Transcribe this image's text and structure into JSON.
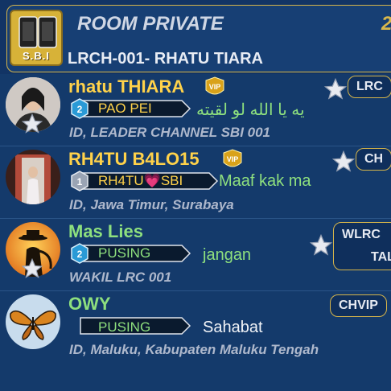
{
  "header": {
    "title": "ROOM PRIVATE",
    "subtitle": "LRCH-001- RHATU TIARA",
    "logo_text": "S.B.I",
    "count_partial": "2"
  },
  "members": [
    {
      "name": "rhatu THIARA",
      "name_color": "#ffd24a",
      "vip": true,
      "level": "2",
      "role": "PAO PEI",
      "message": "يه يا الله لو لقيته",
      "detail": "ID, LEADER CHANNEL SBI 001",
      "tag": "LRC",
      "avatar": "woman-avatar"
    },
    {
      "name": "RH4TU B4LO15",
      "name_color": "#ffd24a",
      "vip": true,
      "level": "1",
      "role": "RH4TU💗SBI",
      "message": "Maaf kak ma",
      "detail": "ID, Jawa Timur, Surabaya",
      "tag": "CH",
      "avatar": "doorway-avatar"
    },
    {
      "name": "Mas Lies",
      "name_color": "#8ee07e",
      "vip": false,
      "level": "2",
      "role": "PUSING",
      "message": "jangan",
      "detail": "WAKIL LRC 001",
      "tag": "WLRC",
      "tag_line2": "TALI",
      "avatar": "cowboy-avatar"
    },
    {
      "name": "OWY",
      "name_color": "#8ee07e",
      "vip": false,
      "level": "",
      "role": "PUSING",
      "message": "Sahabat",
      "detail": "ID, Maluku, Kabupaten Maluku Tengah",
      "tag": "CHVIP",
      "avatar": "butterfly-avatar"
    }
  ]
}
